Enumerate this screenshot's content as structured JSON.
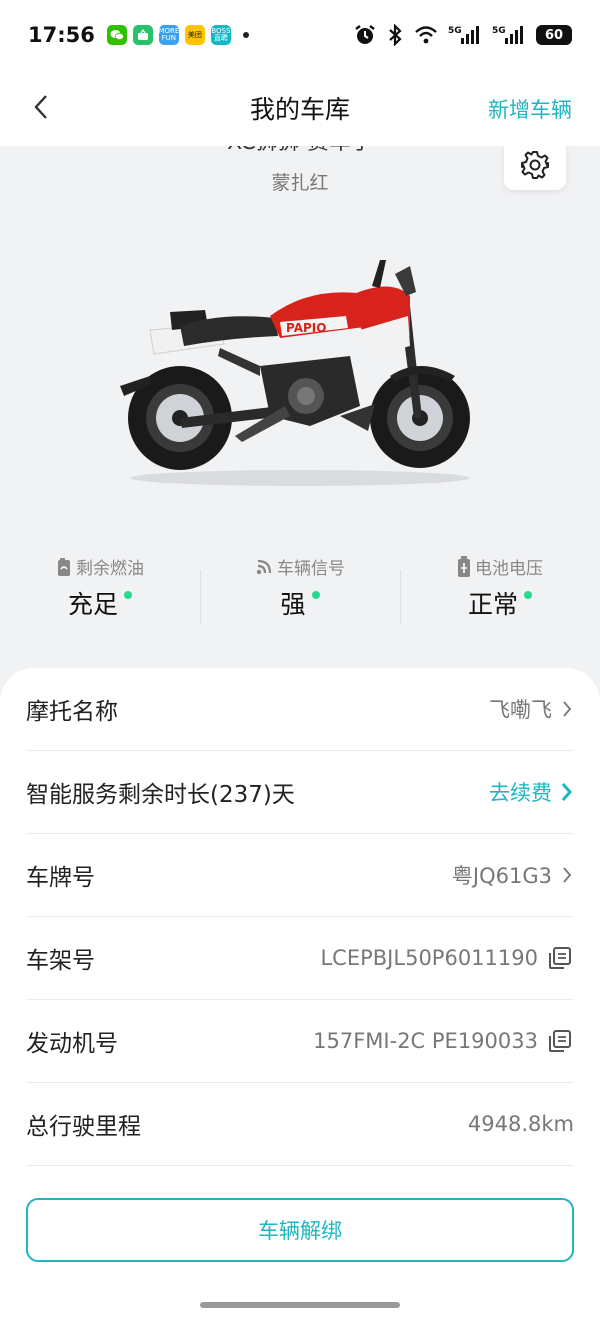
{
  "status_bar": {
    "time": "17:56",
    "apps": [
      {
        "icon": "wechat-icon",
        "label": "",
        "color": "#2dc100"
      },
      {
        "icon": "app-green-icon",
        "label": "",
        "color": "#28c26a"
      },
      {
        "icon": "morefun-icon",
        "label": "MORE FUN",
        "color": "#3aa0f0"
      },
      {
        "icon": "meituan-icon",
        "label": "美团",
        "color": "#ffc300"
      },
      {
        "icon": "boss-icon",
        "label": "BOSS 直聘",
        "color": "#14b8c4"
      }
    ],
    "network_1": "5G",
    "network_2": "5G",
    "battery": "60"
  },
  "nav": {
    "title": "我的车库",
    "add_label": "新增车辆"
  },
  "vehicle": {
    "model_name": "XC狮狮 赛车手",
    "color_name": "蒙扎红"
  },
  "stats": [
    {
      "icon": "fuel-icon",
      "label": "剩余燃油",
      "value": "充足"
    },
    {
      "icon": "signal-icon",
      "label": "车辆信号",
      "value": "强"
    },
    {
      "icon": "battery-voltage-icon",
      "label": "电池电压",
      "value": "正常"
    }
  ],
  "rows": {
    "moto_name": {
      "label": "摩托名称",
      "value": "飞嘞飞"
    },
    "service": {
      "label": "智能服务剩余时长(237)天",
      "value": "去续费"
    },
    "plate": {
      "label": "车牌号",
      "value": "粤JQ61G3"
    },
    "frame": {
      "label": "车架号",
      "value": "LCEPBJL50P6011190"
    },
    "engine": {
      "label": "发动机号",
      "value": "157FMI-2C PE190033"
    },
    "mileage": {
      "label": "总行驶里程",
      "value": "4948.8km"
    }
  },
  "unbind_label": "车辆解绑",
  "colors": {
    "accent": "#1fb5c1",
    "status_ok": "#27d98f",
    "moto_red": "#d8231d"
  }
}
